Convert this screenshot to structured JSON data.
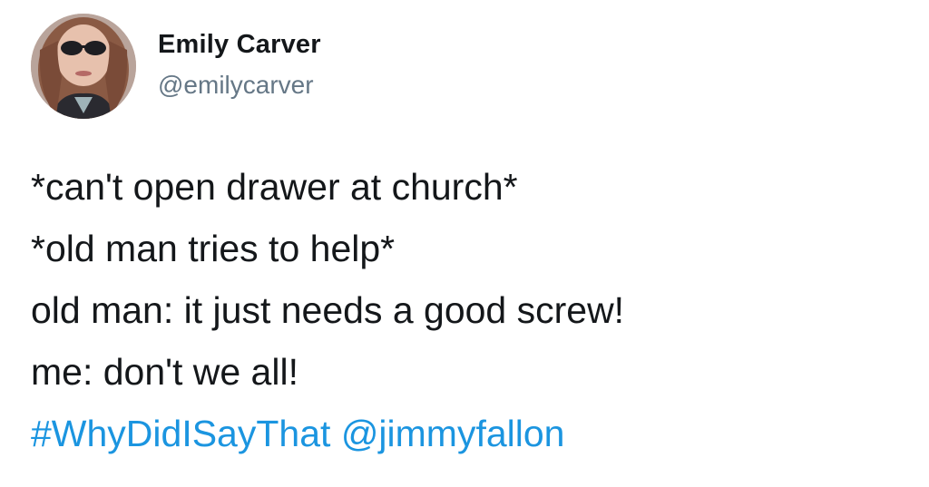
{
  "author": {
    "display_name": "Emily Carver",
    "handle": "@emilycarver",
    "avatar_icon": "profile-photo"
  },
  "tweet": {
    "lines": [
      "*can't open drawer at church*",
      "*old man tries to help*",
      "old man: it just needs a good screw!",
      "me: don't we all!"
    ],
    "hashtag": "#WhyDidISayThat",
    "mention": "@jimmyfallon"
  },
  "colors": {
    "text": "#14171a",
    "handle": "#657786",
    "link": "#1b95e0",
    "background": "#ffffff"
  }
}
